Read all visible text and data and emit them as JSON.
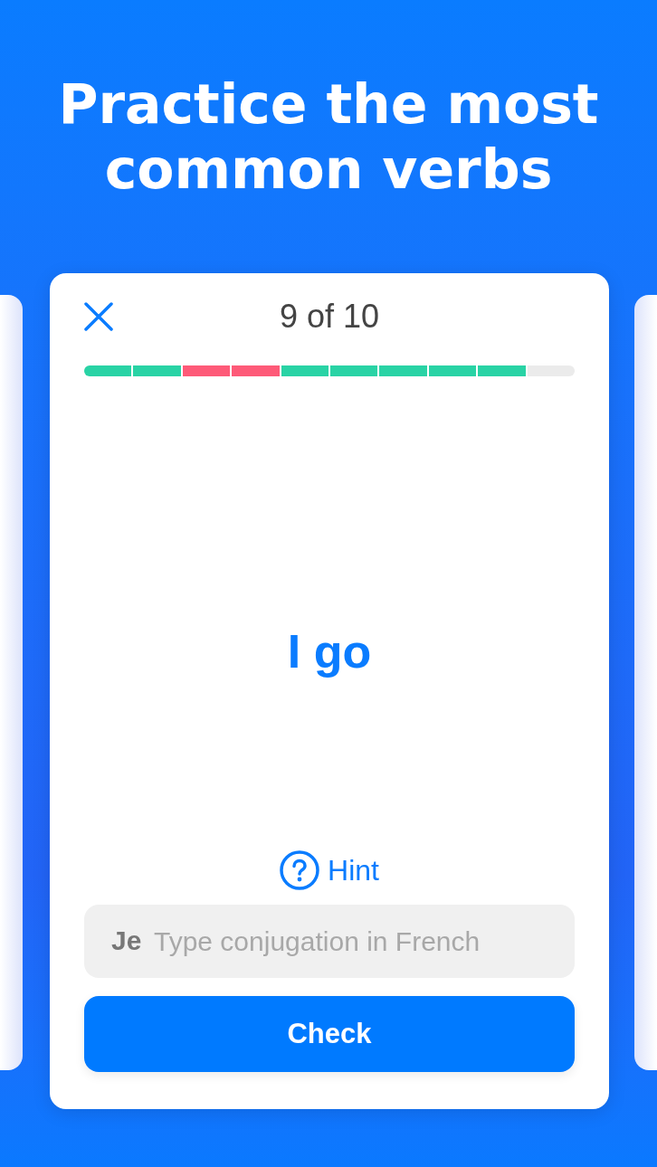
{
  "title": "Practice the most common verbs",
  "card": {
    "counter": "9 of 10",
    "progress": {
      "segments": [
        {
          "color": "#29d3a5"
        },
        {
          "color": "#29d3a5"
        },
        {
          "color": "#fe5a78"
        },
        {
          "color": "#fe5a78"
        },
        {
          "color": "#29d3a5"
        },
        {
          "color": "#29d3a5"
        },
        {
          "color": "#29d3a5"
        },
        {
          "color": "#29d3a5"
        },
        {
          "color": "#29d3a5"
        },
        {
          "color": "#ebebeb"
        }
      ]
    },
    "prompt": "I go",
    "hint": "Hint",
    "answer": {
      "prefix": "Je",
      "placeholder": "Type conjugation in French"
    },
    "button": "Check"
  }
}
